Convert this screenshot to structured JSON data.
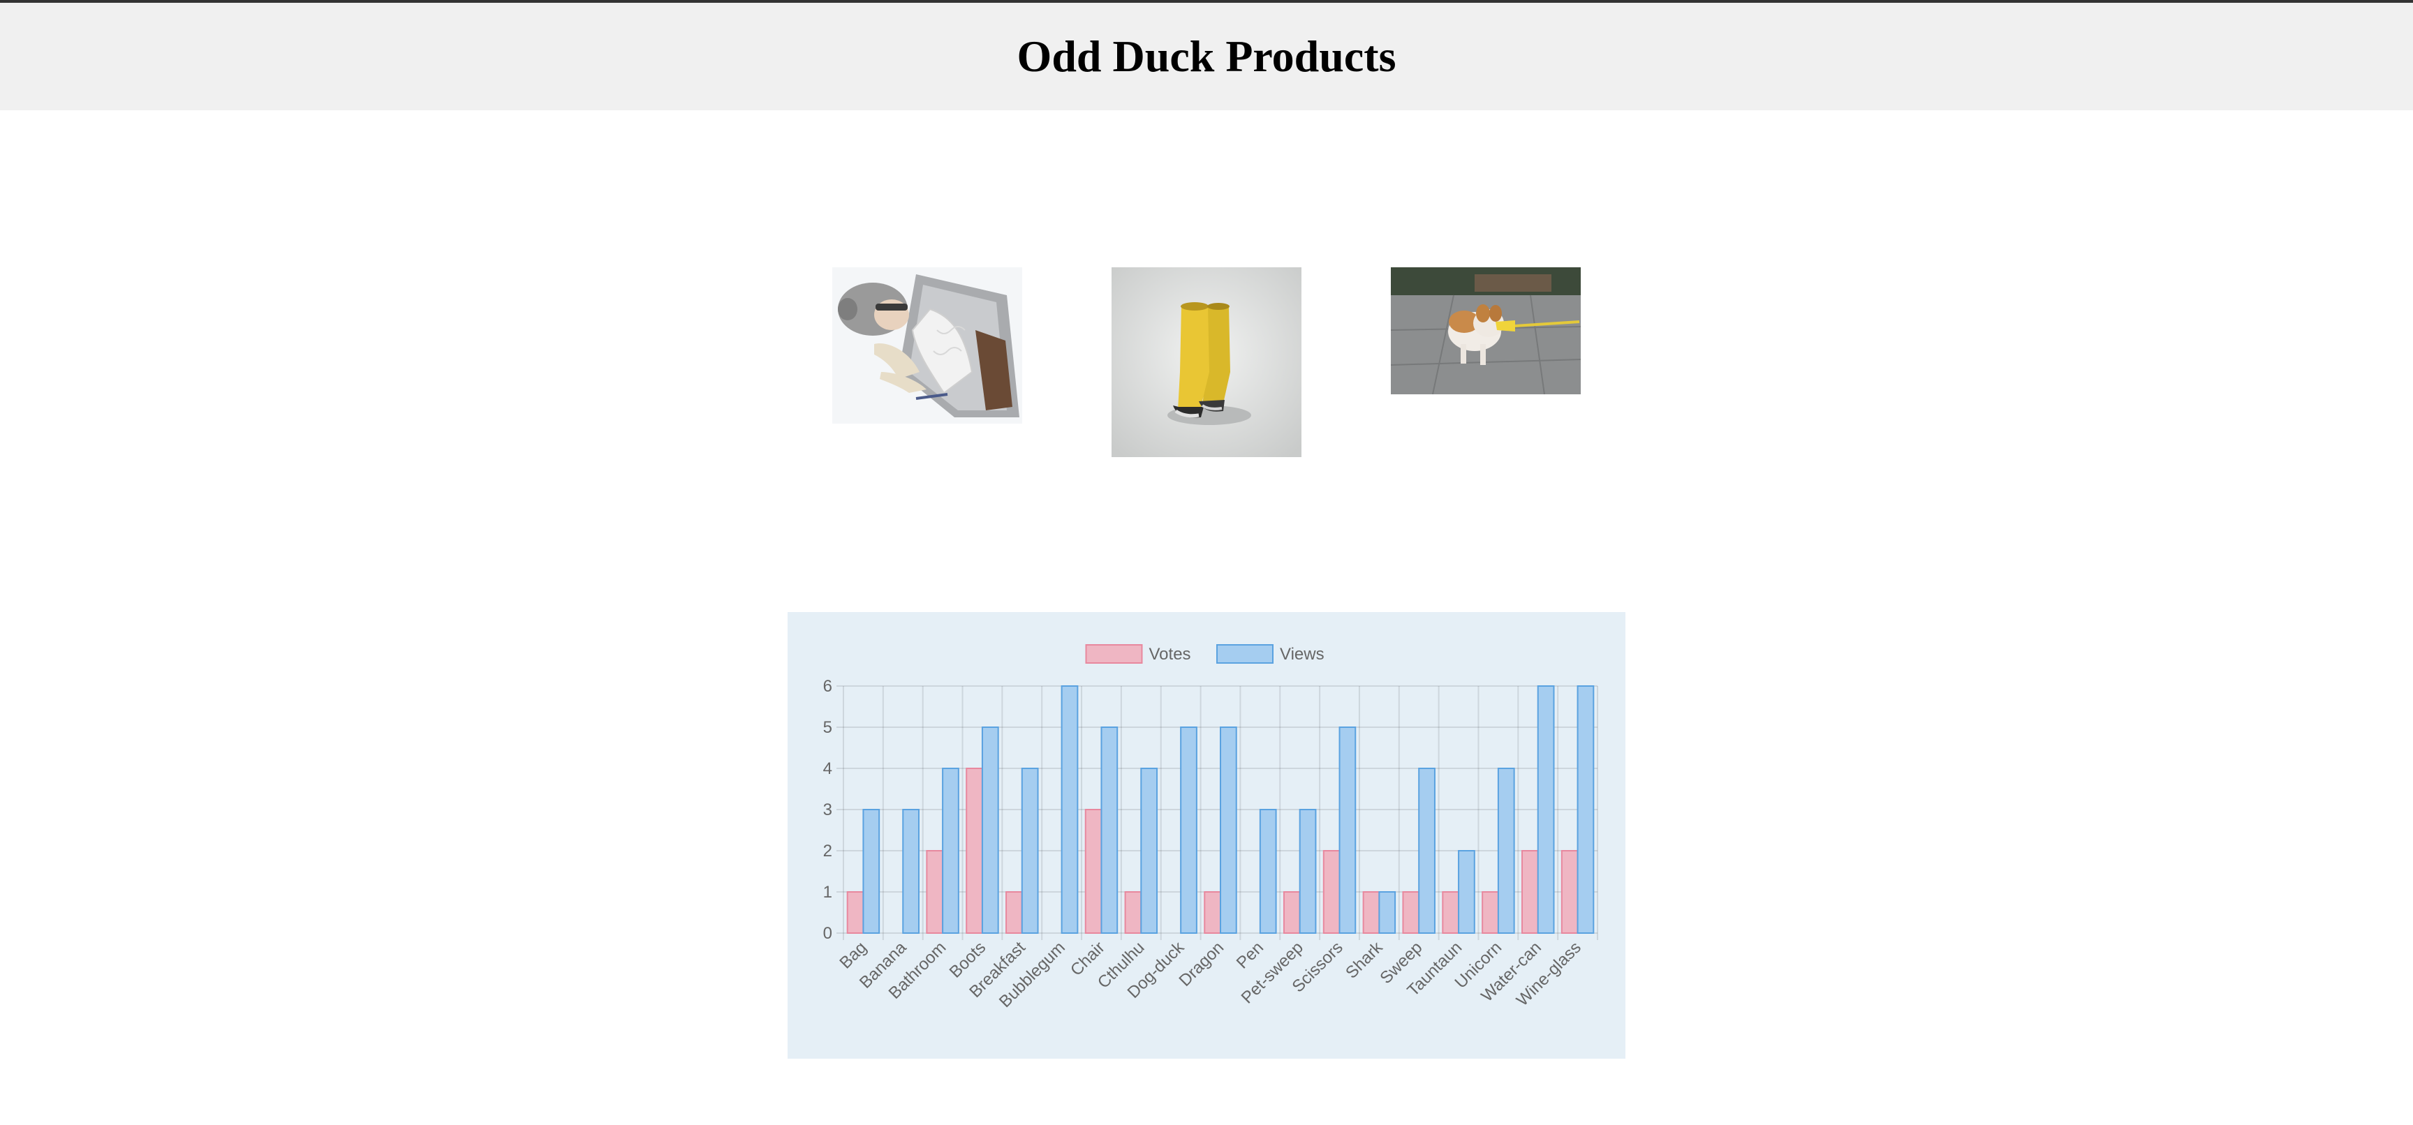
{
  "page": {
    "title": "Odd Duck Products"
  },
  "products": [
    {
      "name": "bag",
      "icon": "sleeping-bag-photo"
    },
    {
      "name": "boots",
      "icon": "yellow-boots-photo"
    },
    {
      "name": "dog-duck",
      "icon": "dog-duck-photo"
    }
  ],
  "chart_data": {
    "type": "bar",
    "categories": [
      "Bag",
      "Banana",
      "Bathroom",
      "Boots",
      "Breakfast",
      "Bubblegum",
      "Chair",
      "Cthulhu",
      "Dog-duck",
      "Dragon",
      "Pen",
      "Pet-sweep",
      "Scissors",
      "Shark",
      "Sweep",
      "Tauntaun",
      "Unicorn",
      "Water-can",
      "Wine-glass"
    ],
    "series": [
      {
        "name": "Votes",
        "values": [
          1,
          0,
          2,
          4,
          1,
          0,
          3,
          1,
          0,
          1,
          0,
          1,
          2,
          1,
          1,
          1,
          1,
          2,
          2
        ],
        "fill": "#efb6c3",
        "stroke": "#e8889e"
      },
      {
        "name": "Views",
        "values": [
          3,
          3,
          4,
          5,
          4,
          6,
          5,
          4,
          5,
          5,
          3,
          3,
          5,
          1,
          4,
          2,
          4,
          6,
          6
        ],
        "fill": "#a5cdf0",
        "stroke": "#5aa2e0"
      }
    ],
    "ylim": [
      0,
      6
    ],
    "yticks": [
      0,
      1,
      2,
      3,
      4,
      5,
      6
    ],
    "grid": true,
    "legend": "top-center",
    "background": "#e5eff6"
  }
}
